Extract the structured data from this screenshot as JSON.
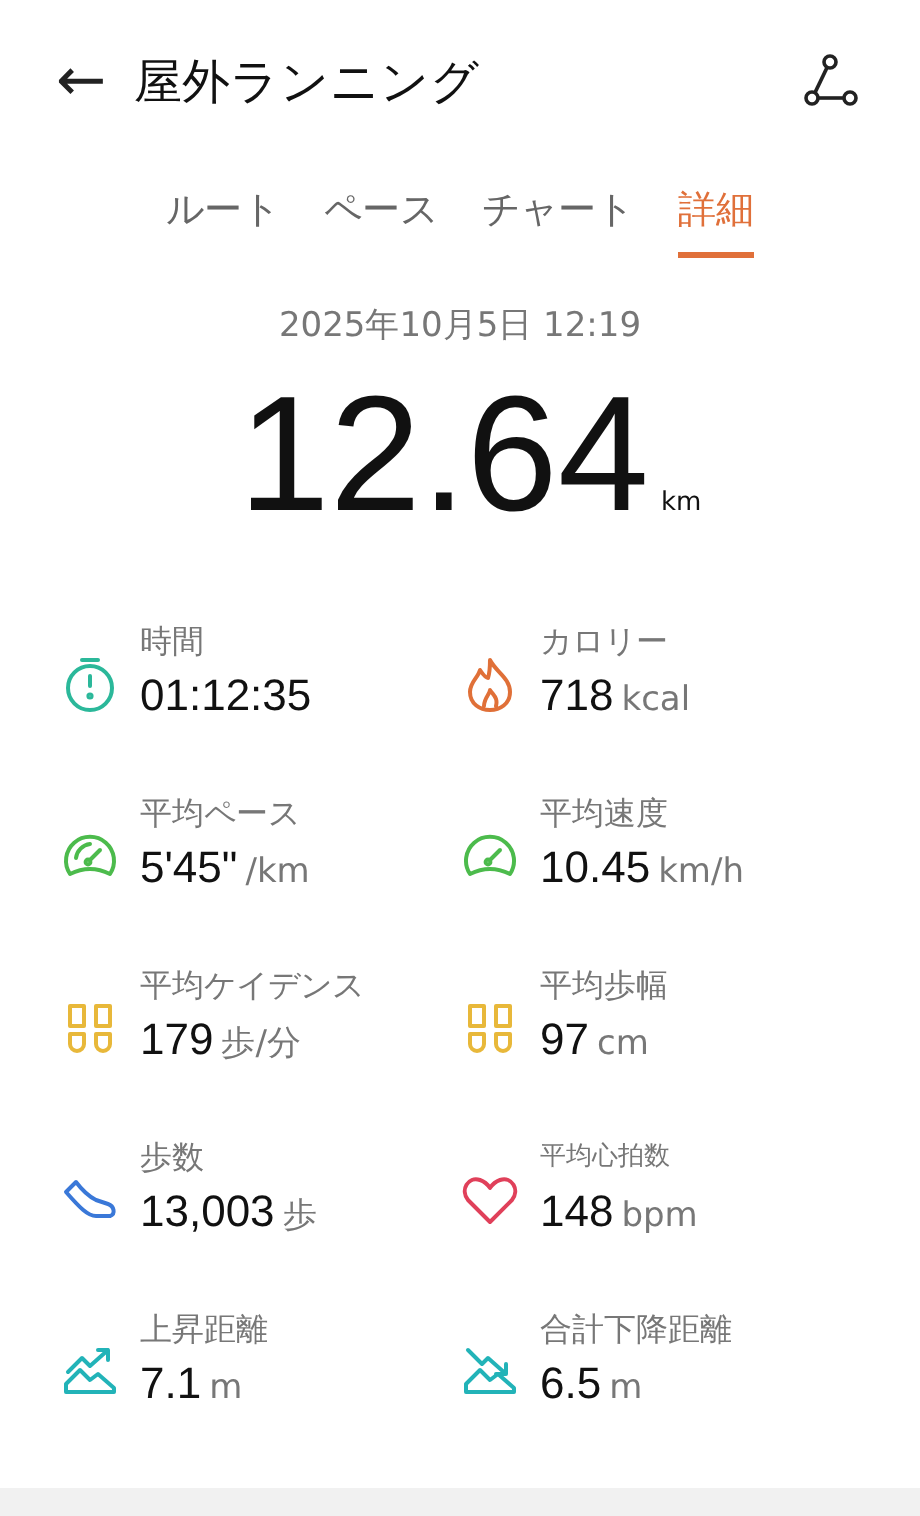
{
  "header": {
    "back_icon": "←",
    "title": "屋外ランニング"
  },
  "tabs": [
    {
      "label": "ルート",
      "selected": false
    },
    {
      "label": "ペース",
      "selected": false
    },
    {
      "label": "チャート",
      "selected": false
    },
    {
      "label": "詳細",
      "selected": true
    }
  ],
  "summary": {
    "date": "2025年10月5日 12:19",
    "distance": "12.64",
    "unit": "km"
  },
  "metrics": [
    {
      "kind": "time",
      "color": "#2bb89a",
      "label": "時間",
      "value": "01:12:35"
    },
    {
      "kind": "calories",
      "color": "#e07038",
      "label": "カロリー",
      "value": "718",
      "unit": "kcal"
    },
    {
      "kind": "pace",
      "color": "#4cbb4c",
      "label": "平均ペース",
      "value": "5'45\"",
      "unit": "/km"
    },
    {
      "kind": "speed",
      "color": "#4cbb4c",
      "label": "平均速度",
      "value": "10.45",
      "unit": "km/h"
    },
    {
      "kind": "cadence",
      "color": "#e8b83a",
      "label": "平均ケイデンス",
      "value": "179",
      "unit": "歩/分"
    },
    {
      "kind": "stride",
      "color": "#e8b83a",
      "label": "平均歩幅",
      "value": "97",
      "unit": "cm"
    },
    {
      "kind": "steps",
      "color": "#3a78d8",
      "label": "歩数",
      "value": "13,003",
      "unit": "歩"
    },
    {
      "kind": "heart_rate",
      "color": "#e0405a",
      "label": "平均心拍数",
      "value": "148",
      "unit": "bpm"
    },
    {
      "kind": "ascent",
      "color": "#22b3b8",
      "label": "上昇距離",
      "value": "7.1",
      "unit": "m"
    },
    {
      "kind": "descent",
      "color": "#22b3b8",
      "label": "合計下降距離",
      "value": "6.5",
      "unit": "m"
    }
  ]
}
